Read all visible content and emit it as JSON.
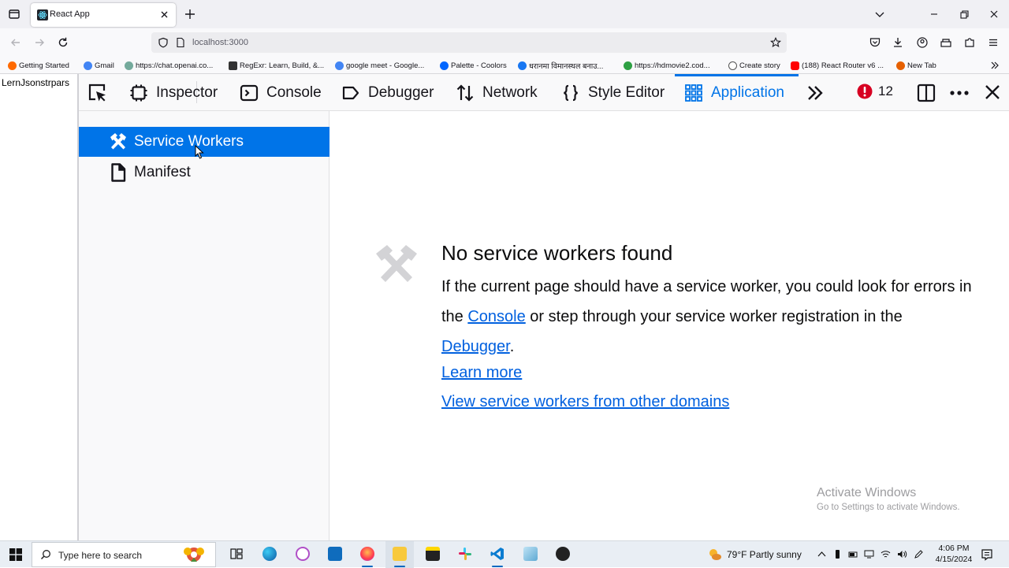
{
  "browser": {
    "tab_title": "React App",
    "url": "localhost:3000",
    "bookmarks": [
      {
        "label": "Getting Started",
        "color": "#ff6a00"
      },
      {
        "label": "Gmail",
        "color": "#4285f4"
      },
      {
        "label": "https://chat.openai.co...",
        "color": "#74aa9c"
      },
      {
        "label": "RegExr: Learn, Build, &...",
        "color": "#333333"
      },
      {
        "label": "google meet - Google...",
        "color": "#4285f4"
      },
      {
        "label": "Palette - Coolors",
        "color": "#0066ff"
      },
      {
        "label": "धरानमा विमानस्थल बनाउ...",
        "color": "#1877f2"
      },
      {
        "label": "https://hdmovie2.cod...",
        "color": "#2ea043"
      },
      {
        "label": "Create story",
        "color": "#555555"
      },
      {
        "label": "(188) React Router v6 ...",
        "color": "#ff0000"
      },
      {
        "label": "New Tab",
        "color": "#e66000"
      }
    ]
  },
  "page": {
    "text": "LernJsonstrpars"
  },
  "devtools": {
    "tabs": {
      "inspector": "Inspector",
      "console": "Console",
      "debugger": "Debugger",
      "network": "Network",
      "style_editor": "Style Editor",
      "application": "Application"
    },
    "error_count": "12",
    "accent_color": "#0074e8",
    "sidebar": {
      "service_workers": "Service Workers",
      "manifest": "Manifest"
    },
    "main": {
      "title": "No service workers found",
      "body_1": "If the current page should have a service worker, you could look for errors in the ",
      "console_link": "Console",
      "body_2": " or step through your service worker registration in the ",
      "debugger_link": "Debugger",
      "body_3": ".",
      "learn_more": "Learn more",
      "other_domains": "View service workers from other domains"
    }
  },
  "watermark": {
    "line1": "Activate Windows",
    "line2": "Go to Settings to activate Windows."
  },
  "taskbar": {
    "search_placeholder": "Type here to search",
    "weather": "79°F  Partly sunny",
    "time": "4:06 PM",
    "date": "4/15/2024"
  }
}
